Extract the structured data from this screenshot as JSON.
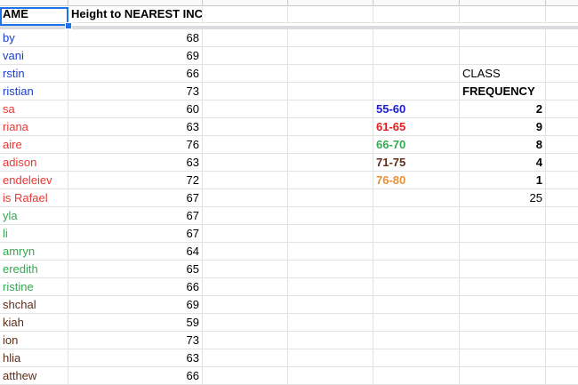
{
  "header": {
    "name_col": "AME",
    "height_col": "Height to NEAREST INCH"
  },
  "students": [
    {
      "name": "by",
      "height": "68",
      "color": "#1c3fcf"
    },
    {
      "name": "vani",
      "height": "69",
      "color": "#1c3fcf"
    },
    {
      "name": "rstin",
      "height": "66",
      "color": "#1c3fcf"
    },
    {
      "name": "ristian",
      "height": "73",
      "color": "#1c3fcf"
    },
    {
      "name": "sa",
      "height": "60",
      "color": "#e53935"
    },
    {
      "name": "riana",
      "height": "63",
      "color": "#e53935"
    },
    {
      "name": "aire",
      "height": "76",
      "color": "#e53935"
    },
    {
      "name": "adison",
      "height": "63",
      "color": "#e53935"
    },
    {
      "name": "endeleiev",
      "height": "72",
      "color": "#e53935"
    },
    {
      "name": "is Rafael",
      "height": "67",
      "color": "#e53935"
    },
    {
      "name": "yla",
      "height": "67",
      "color": "#34a853"
    },
    {
      "name": "li",
      "height": "67",
      "color": "#34a853"
    },
    {
      "name": "amryn",
      "height": "64",
      "color": "#34a853"
    },
    {
      "name": "eredith",
      "height": "65",
      "color": "#34a853"
    },
    {
      "name": "ristine",
      "height": "66",
      "color": "#34a853"
    },
    {
      "name": "shchal",
      "height": "69",
      "color": "#5d2e1a"
    },
    {
      "name": "kiah",
      "height": "59",
      "color": "#5d2e1a"
    },
    {
      "name": "ion",
      "height": "73",
      "color": "#5d2e1a"
    },
    {
      "name": "hlia",
      "height": "63",
      "color": "#5d2e1a"
    },
    {
      "name": "atthew",
      "height": "66",
      "color": "#5d2e1a"
    }
  ],
  "freq_table": {
    "class_label": "CLASS",
    "frequency_label": "FREQUENCY",
    "rows": [
      {
        "range": "55-60",
        "count": "2",
        "color": "#1c1ccf"
      },
      {
        "range": "61-65",
        "count": "9",
        "color": "#e02020"
      },
      {
        "range": "66-70",
        "count": "8",
        "color": "#34a853"
      },
      {
        "range": "71-75",
        "count": "4",
        "color": "#5d2e1a"
      },
      {
        "range": "76-80",
        "count": "1",
        "color": "#e69138"
      }
    ],
    "total": "25"
  }
}
